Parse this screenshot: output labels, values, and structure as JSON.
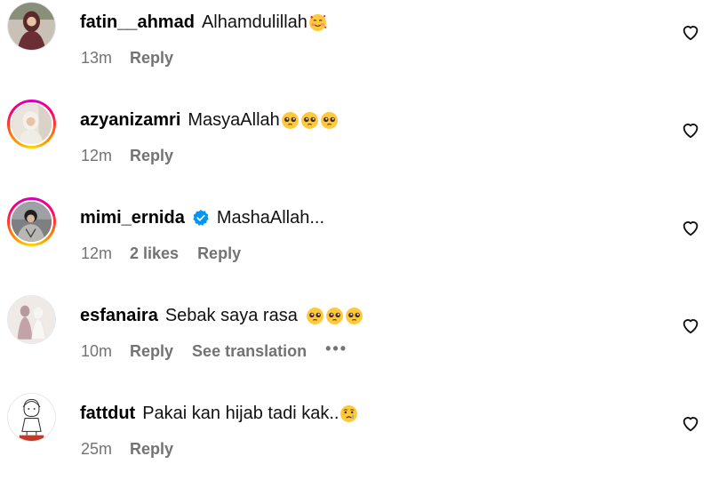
{
  "comments": [
    {
      "username": "fatin__ahmad",
      "text": "Alhamdulillah",
      "emojis": [
        "smiling-face-with-hearts"
      ],
      "time": "13m",
      "likes": "",
      "reply_label": "Reply",
      "avatar_icon": "profile-photo",
      "story_ring": false,
      "verified": false
    },
    {
      "username": "azyanizamri",
      "text": "MasyaAllah",
      "emojis": [
        "pleading-face",
        "pleading-face",
        "pleading-face"
      ],
      "time": "12m",
      "likes": "",
      "reply_label": "Reply",
      "avatar_icon": "profile-photo",
      "story_ring": true,
      "verified": false
    },
    {
      "username": "mimi_ernida",
      "text": "MashaAllah...",
      "emojis": [],
      "time": "12m",
      "likes": "2 likes",
      "reply_label": "Reply",
      "avatar_icon": "profile-photo",
      "story_ring": true,
      "verified": true
    },
    {
      "username": "esfanaira",
      "text": "Sebak saya rasa",
      "emojis": [
        "pleading-face",
        "pleading-face",
        "pleading-face"
      ],
      "time": "10m",
      "likes": "",
      "reply_label": "Reply",
      "see_translation_label": "See translation",
      "more_label": "•••",
      "avatar_icon": "profile-photo",
      "story_ring": false,
      "verified": false
    },
    {
      "username": "fattdut",
      "text": "Pakai kan hijab tadi kak..",
      "emojis": [
        "crying-face"
      ],
      "time": "25m",
      "likes": "",
      "reply_label": "Reply",
      "avatar_icon": "profile-illustration",
      "story_ring": false,
      "verified": false
    }
  ],
  "colors": {
    "secondary_text": "#737373",
    "verified_blue": "#0095f6",
    "emoji_yellow": "#ffc93a"
  },
  "icons": {
    "like": "heart-outline-icon",
    "verified": "verified-badge-icon"
  }
}
